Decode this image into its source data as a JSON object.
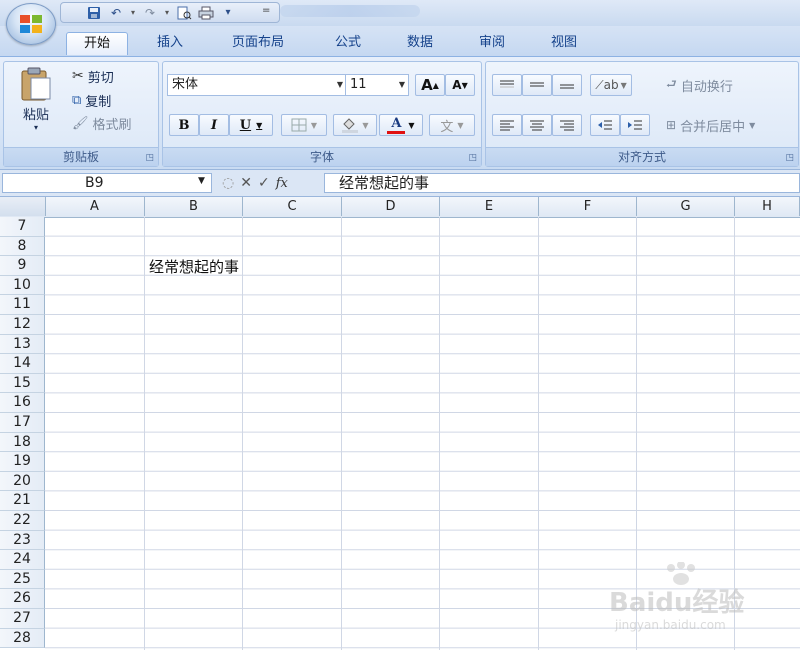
{
  "qat": {
    "more": "="
  },
  "tabs": [
    "开始",
    "插入",
    "页面布局",
    "公式",
    "数据",
    "审阅",
    "视图"
  ],
  "clipboard": {
    "paste": "粘贴",
    "cut": "剪切",
    "copy": "复制",
    "format_painter": "格式刷",
    "group_label": "剪贴板"
  },
  "font": {
    "name": "宋体",
    "size": "11",
    "grow": "A",
    "shrink": "A",
    "bold": "B",
    "italic": "I",
    "underline": "U",
    "font_color_label": "A",
    "phonetic": "文",
    "group_label": "字体"
  },
  "alignment": {
    "wrap_text": "自动换行",
    "merge_center": "合并后居中",
    "group_label": "对齐方式"
  },
  "formula_bar": {
    "name_box": "B9",
    "fx": "fx",
    "content": "经常想起的事"
  },
  "grid": {
    "columns": [
      "A",
      "B",
      "C",
      "D",
      "E",
      "F",
      "G",
      "H"
    ],
    "rows": [
      "7",
      "8",
      "9",
      "10",
      "11",
      "12",
      "13",
      "14",
      "15",
      "16",
      "17",
      "18",
      "19",
      "20",
      "21",
      "22",
      "23",
      "24",
      "25",
      "26",
      "27",
      "28"
    ],
    "cells": [
      {
        "ref": "B9",
        "value": "经常想起的事"
      }
    ]
  },
  "watermark": {
    "brand": "Baidu经验",
    "url": "jingyan.baidu.com"
  },
  "colors": {
    "accent": "#15428b",
    "ribbon_bg": "#dbe7f7",
    "grid_line": "#d0d7e5",
    "font_color_bar": "#e01010"
  }
}
